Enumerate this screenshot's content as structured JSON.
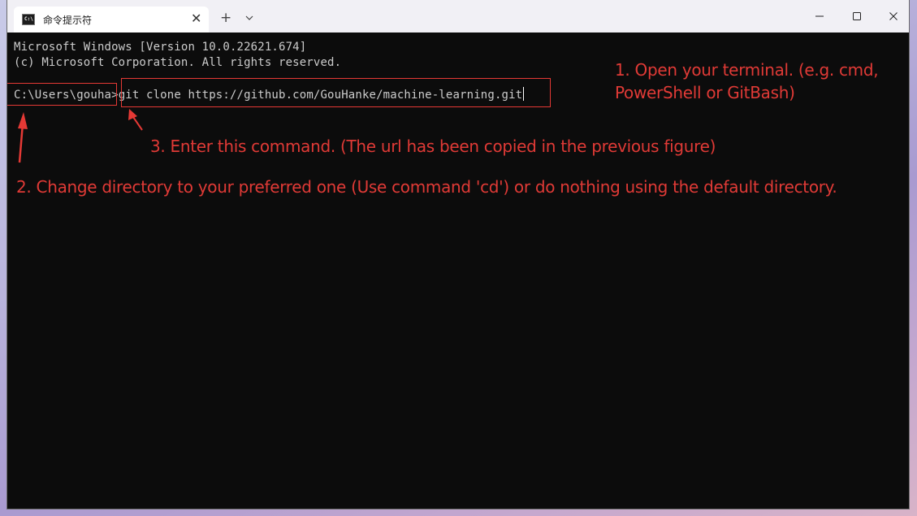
{
  "window": {
    "tab_title": "命令提示符",
    "tab_icon_text": "C:\\",
    "tab_icon": "cmd-icon",
    "new_tab_label": "+"
  },
  "console": {
    "line1": "Microsoft Windows [Version 10.0.22621.674]",
    "line2": "(c) Microsoft Corporation. All rights reserved.",
    "prompt": "C:\\Users\\gouha>",
    "command": "git clone https://github.com/GouHanke/machine-learning.git"
  },
  "annotations": {
    "step1_line1": "1. Open your terminal. (e.g. cmd,",
    "step1_line2": "PowerShell or GitBash)",
    "step2": "2. Change directory to your preferred one (Use command 'cd') or do nothing using the default directory.",
    "step3": "3. Enter this command. (The url has been copied in the previous figure)",
    "color": "#e03a36"
  },
  "colors": {
    "console_bg": "#0c0c0c",
    "console_text": "#cccccc",
    "titlebar_bg": "#f1f0f5",
    "annotation_red": "#e03a36"
  }
}
